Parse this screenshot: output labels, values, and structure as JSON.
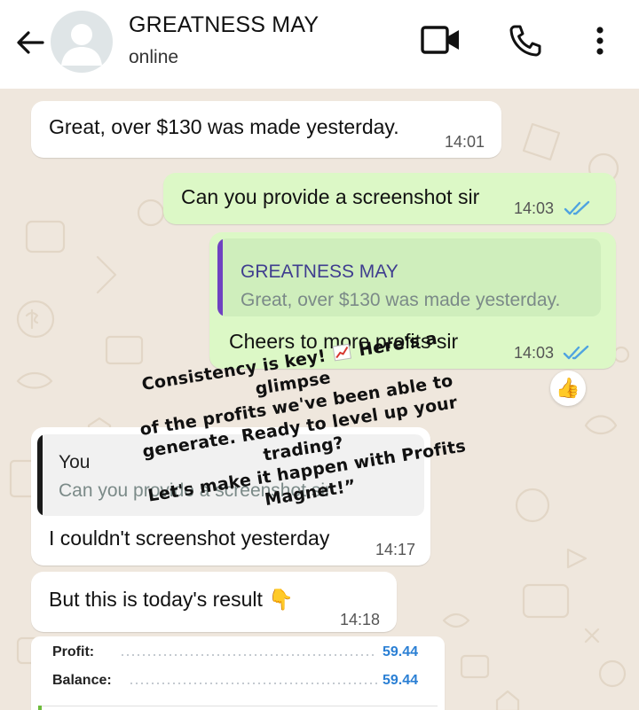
{
  "contact": {
    "name": "GREATNESS MAY",
    "status": "online"
  },
  "messages": [
    {
      "direction": "incoming",
      "text": "Great, over $130 was made yesterday.",
      "time": "14:01"
    },
    {
      "direction": "outgoing",
      "text": "Can you provide a screenshot sir",
      "time": "14:03",
      "read": true
    },
    {
      "direction": "outgoing",
      "quote": {
        "author": "GREATNESS MAY",
        "text": "Great, over $130 was made yesterday."
      },
      "text": "Cheers to more profits sir",
      "time": "14:03",
      "read": true,
      "reaction": "👍"
    },
    {
      "direction": "incoming",
      "quote": {
        "author": "You",
        "text": "Can you provide a screenshot sir"
      },
      "text": "I couldn't screenshot yesterday",
      "time": "14:17"
    },
    {
      "direction": "incoming",
      "text": "But this is today's result",
      "emoji": "👇",
      "time": "14:18"
    }
  ],
  "overlay_caption": {
    "lines": [
      "Consistency is key!",
      "Here's a glimpse",
      "of the profits we've been able to",
      "generate. Ready to level up your trading?",
      "Let's make it happen with Profits",
      "Magnet!”"
    ]
  },
  "result_card": {
    "rows": [
      {
        "label": "Profit:",
        "value": "59.44"
      },
      {
        "label": "Balance:",
        "value": "59.44"
      }
    ]
  },
  "colors": {
    "header_bg": "#ffffff",
    "chat_bg": "#efe7dd",
    "incoming_bubble": "#ffffff",
    "outgoing_bubble": "#dcf8c6",
    "read_ticks": "#4fa3e0",
    "quote_bar_incoming_reply": "#6f42c1",
    "quote_bar_outgoing_reply": "#1a1a1a",
    "quote_author_color": "#3f3d8f",
    "value_blue": "#2a7fd4"
  },
  "icons": [
    "back-arrow-icon",
    "avatar-placeholder-icon",
    "video-call-icon",
    "phone-call-icon",
    "more-options-icon",
    "read-receipt-icon",
    "thumbs-up-reaction-icon",
    "pointing-down-emoji",
    "chart-increasing-emoji"
  ]
}
